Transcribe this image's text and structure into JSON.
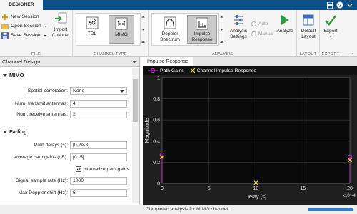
{
  "tabs": {
    "active": "DESIGNER"
  },
  "ribbon": {
    "file": {
      "label": "FILE",
      "new_session": "New Session",
      "open_session": "Open Session",
      "save_session": "Save Session",
      "import_channel": [
        "Import",
        "Channel"
      ]
    },
    "channel_type": {
      "label": "CHANNEL TYPE",
      "tdl": "TDL",
      "tdl_icon_text": "5G",
      "mimo": "MIMO",
      "selected": "MIMO"
    },
    "analysis": {
      "label": "ANALYSIS",
      "doppler_spectrum": [
        "Doppler",
        "Spectrum"
      ],
      "impulse_response": [
        "Impulse",
        "Response"
      ],
      "selected": "Impulse Response",
      "analysis_settings": [
        "Analysis",
        "Settings"
      ],
      "auto": "Auto",
      "manual": "Manual",
      "analyze": "Analyze"
    },
    "layout": {
      "label": "LAYOUT",
      "default_layout": [
        "Default",
        "Layout"
      ]
    },
    "export": {
      "label": "EXPORT",
      "export": "Export"
    }
  },
  "channel_design": {
    "title": "Channel Design",
    "mimo_group": "MIMO",
    "spatial_correlation_label": "Spatial correlation:",
    "spatial_correlation_value": "None",
    "num_tx_label": "Num. transmit antennas:",
    "num_tx_value": "4",
    "num_rx_label": "Num. receive antennas:",
    "num_rx_value": "2",
    "fading_group": "Fading",
    "path_delays_label": "Path delays (s):",
    "path_delays_value": "[0 2e-3]",
    "avg_path_gains_label": "Average path gains (dB):",
    "avg_path_gains_value": "[0 -5]",
    "normalize_label": "Normalize path gains",
    "normalize_checked": true,
    "sample_rate_label": "Signal sample rate (Hz):",
    "sample_rate_value": "1000",
    "max_doppler_label": "Max Doppler shift (Hz):",
    "max_doppler_value": "5"
  },
  "plot": {
    "tab_title": "Impulse Response",
    "legend": [
      "Path Gains",
      "Channel Impulse Response"
    ],
    "colors": {
      "path_gains": "#d030d0",
      "impulse": "#e8e020",
      "background": "#0a0a0a",
      "grid": "#3a3a3a"
    }
  },
  "chart_data": {
    "type": "scatter",
    "title": "",
    "xlabel": "Delay (s)",
    "ylabel": "Magnitude",
    "x_exponent": "x10^-4",
    "xlim": [
      0,
      20
    ],
    "ylim": [
      0,
      1
    ],
    "xticks": [
      0,
      5,
      10,
      15,
      20
    ],
    "xtick_labels": [
      "0",
      "5",
      "10",
      "15",
      "20"
    ],
    "yticks": [
      0,
      0.2,
      0.4,
      0.6,
      0.8,
      1
    ],
    "ytick_labels": [
      "0",
      "0.2",
      "0.4",
      "0.6",
      "0.8",
      "1"
    ],
    "grid": true,
    "legend_position": "top",
    "series": [
      {
        "name": "Path Gains",
        "marker": "stem-circle",
        "x": [
          0,
          20
        ],
        "y": [
          0.27,
          0.25
        ]
      },
      {
        "name": "Channel Impulse Response",
        "marker": "x",
        "x": [
          0,
          10,
          20
        ],
        "y": [
          0.25,
          0.005,
          0.22
        ]
      }
    ]
  },
  "status": {
    "message": "Completed analysis for MIMO channel.",
    "progress": 1.0
  }
}
